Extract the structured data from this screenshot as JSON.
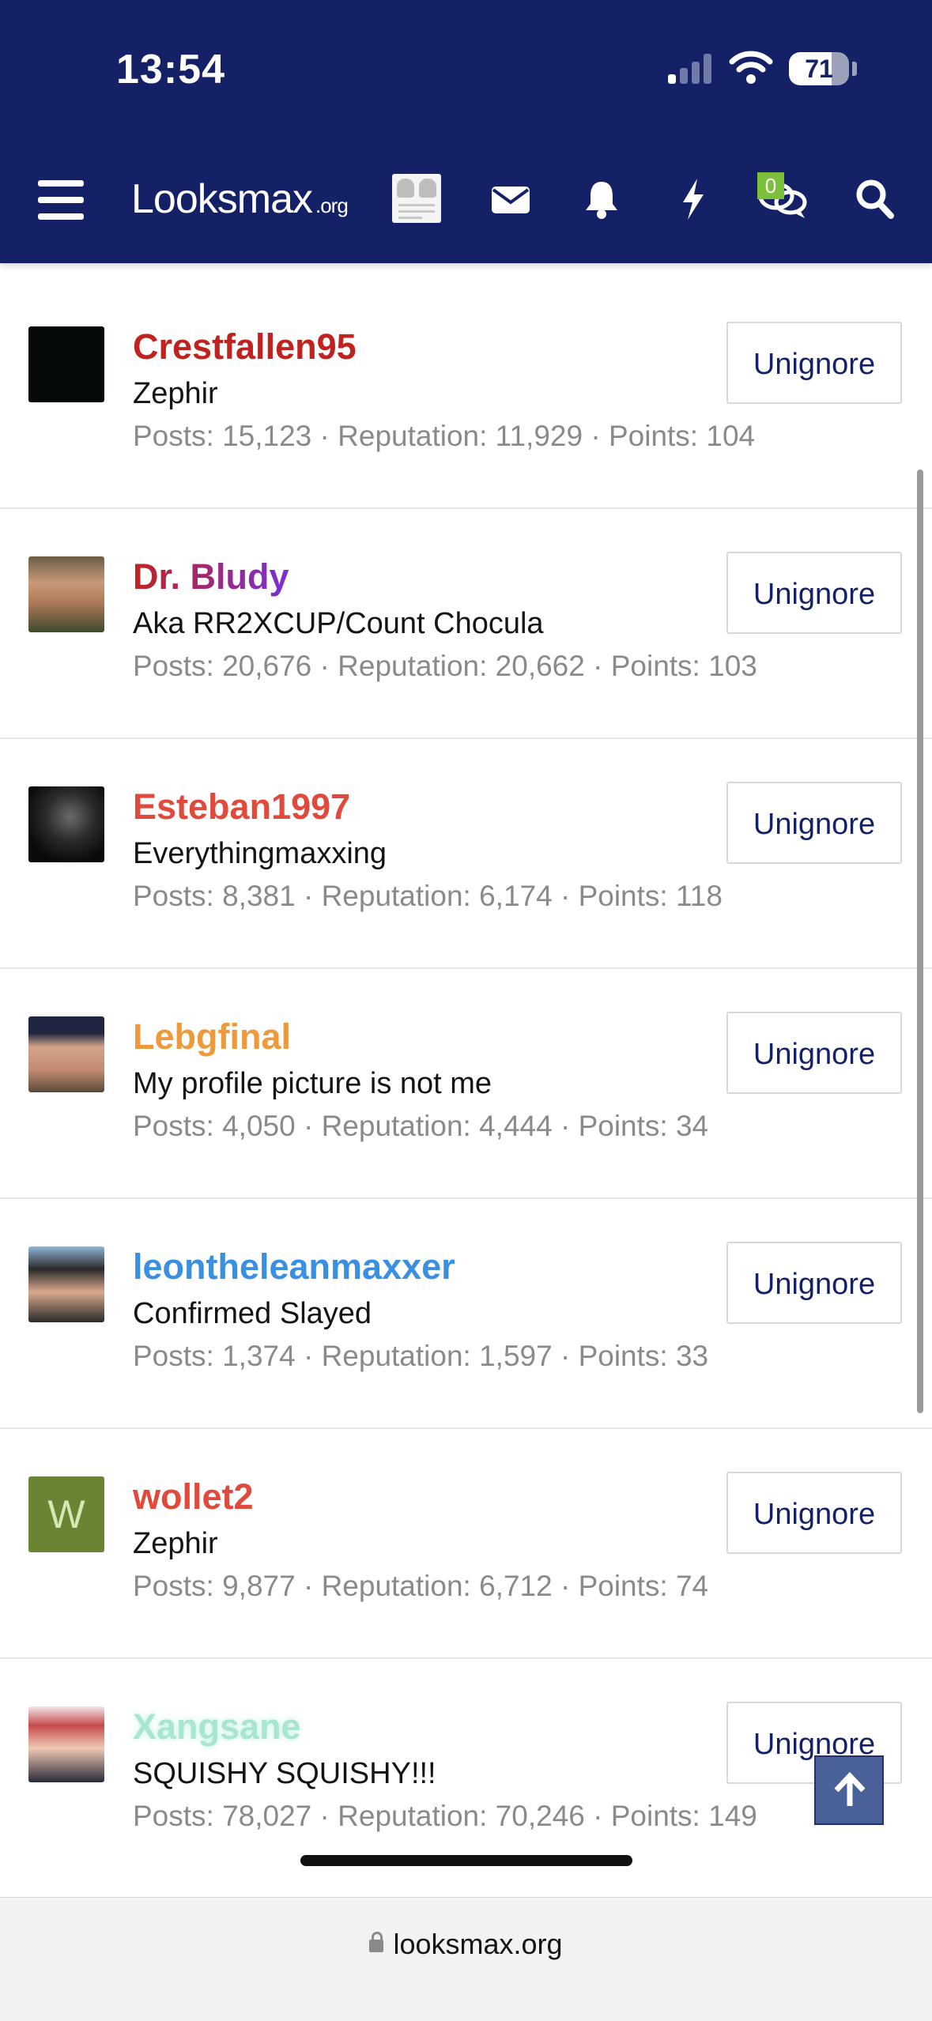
{
  "status_bar": {
    "time": "13:54",
    "battery": "71",
    "battery_level": 0.71
  },
  "header": {
    "logo_main": "Looksmax",
    "logo_suffix": ".org",
    "alerts_count": "0",
    "icons": [
      "menu-icon",
      "envelope-icon",
      "bell-icon",
      "lightning-icon",
      "chat-bubbles-icon",
      "search-icon"
    ]
  },
  "members": [
    {
      "name": "Crestfallen95",
      "name_color": "#c0231f",
      "title": "Zephir",
      "stats": "Posts: 15,123 · Reputation: 11,929 · Points: 104",
      "button": "Unignore"
    },
    {
      "name": "Dr. Bludy",
      "name_color": "gradient:#c0231f-#7a2fd6",
      "title": "Aka RR2XCUP/Count Chocula",
      "stats": "Posts: 20,676 · Reputation: 20,662 · Points: 103",
      "button": "Unignore"
    },
    {
      "name": "Esteban1997",
      "name_color": "#e04a3c",
      "title": "Everythingmaxxing",
      "stats": "Posts: 8,381 · Reputation: 6,174 · Points: 118",
      "button": "Unignore"
    },
    {
      "name": "Lebgfinal",
      "name_color": "#ef9a3a",
      "title": "My profile picture is not me",
      "stats": "Posts: 4,050 · Reputation: 4,444 · Points: 34",
      "button": "Unignore"
    },
    {
      "name": "leontheleanmaxxer",
      "name_color": "#3a8fe0",
      "title": "Confirmed Slayed",
      "stats": "Posts: 1,374 · Reputation: 1,597 · Points: 33",
      "button": "Unignore"
    },
    {
      "name": "wollet2",
      "name_color": "#e04a3c",
      "avatar_letter": "W",
      "title": "Zephir",
      "stats": "Posts: 9,877 · Reputation: 6,712 · Points: 74",
      "button": "Unignore"
    },
    {
      "name": "Xangsane",
      "name_color": "#a8e6d0",
      "title": "SQUISHY SQUISHY!!!",
      "stats": "Posts: 78,027 · Reputation: 70,246 · Points: 149",
      "button": "Unignore"
    }
  ],
  "footer": {
    "url": "looksmax.org"
  }
}
